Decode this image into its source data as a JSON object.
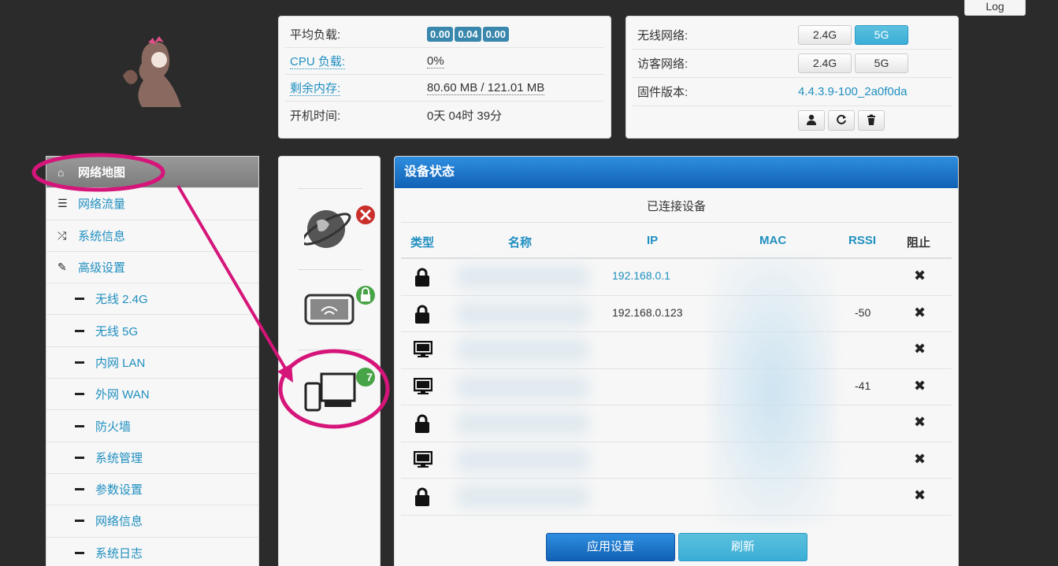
{
  "header": {
    "log_label": "Log"
  },
  "stats": {
    "load_label": "平均负载:",
    "load_values": [
      "0.00",
      "0.04",
      "0.00"
    ],
    "cpu_label": "CPU 负载:",
    "cpu_value": "0%",
    "mem_label": "剩余内存:",
    "mem_value": "80.60 MB / 121.01 MB",
    "uptime_label": "开机时间:",
    "uptime_value": "0天 04时 39分"
  },
  "wifi": {
    "wireless_label": "无线网络:",
    "guest_label": "访客网络:",
    "firmware_label": "固件版本:",
    "firmware_value": "4.4.3.9-100_2a0f0da",
    "band_24": "2.4G",
    "band_5": "5G"
  },
  "sidebar": {
    "items": [
      {
        "label": "网络地图",
        "icon": "home-icon"
      },
      {
        "label": "网络流量",
        "icon": "list-icon"
      },
      {
        "label": "系统信息",
        "icon": "shuffle-icon"
      },
      {
        "label": "高级设置",
        "icon": "wrench-icon"
      }
    ],
    "sub": [
      "无线 2.4G",
      "无线 5G",
      "内网 LAN",
      "外网 WAN",
      "防火墙",
      "系统管理",
      "参数设置",
      "网络信息",
      "系统日志"
    ]
  },
  "iconcol": {
    "device_count": "7"
  },
  "devices": {
    "panel_title": "设备状态",
    "table_title": "已连接设备",
    "headers": {
      "type": "类型",
      "name": "名称",
      "ip": "IP",
      "mac": "MAC",
      "rssi": "RSSI",
      "block": "阻止"
    },
    "rows": [
      {
        "type": "lock-icon",
        "ip": "192.168.0.1",
        "ip_link": true,
        "rssi": ""
      },
      {
        "type": "lock-icon",
        "ip": "192.168.0.123",
        "ip_link": false,
        "rssi": "-50"
      },
      {
        "type": "monitor-icon",
        "ip": "",
        "ip_link": false,
        "rssi": ""
      },
      {
        "type": "monitor-icon",
        "ip": "",
        "ip_link": false,
        "rssi": "-41"
      },
      {
        "type": "lock-icon",
        "ip": "",
        "ip_link": false,
        "rssi": ""
      },
      {
        "type": "monitor-icon",
        "ip": "",
        "ip_link": false,
        "rssi": ""
      },
      {
        "type": "lock-icon",
        "ip": "",
        "ip_link": false,
        "rssi": ""
      }
    ],
    "apply_label": "应用设置",
    "refresh_label": "刷新"
  },
  "colors": {
    "accent": "#1f8fc0",
    "header_blue": "#1161b5",
    "annotation": "#d6157a"
  }
}
